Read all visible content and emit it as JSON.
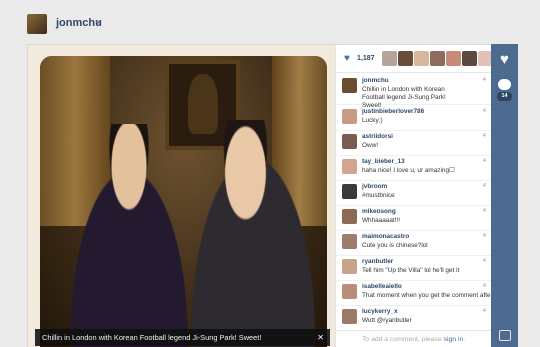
{
  "header": {
    "username": "jonmchu",
    "dropdown_icon": "chevron-down-icon"
  },
  "photo": {
    "caption": "Chillin in London with Korean Football legend Ji-Sung Park! Sweet!",
    "close_icon": "close-icon"
  },
  "likes": {
    "count": "1,187",
    "icon": "heart-icon",
    "liker_colors": [
      "#b5a49a",
      "#6a4c3a",
      "#d9b59b",
      "#8d6c5e",
      "#c98a7a",
      "#5b4a40",
      "#e2c2b6"
    ]
  },
  "comments": [
    {
      "user": "jonmchu",
      "text": "Chillin in London with Korean Football legend Ji-Sung Park! Sweet!",
      "time": "4",
      "avatar_color": "#6b4e2e"
    },
    {
      "user": "justinbieberlover786",
      "text": "Lucky;)",
      "time": "4",
      "avatar_color": "#c79a84"
    },
    {
      "user": "astriidorsi",
      "text": "Oww!",
      "time": "4",
      "avatar_color": "#7a5d52"
    },
    {
      "user": "tay_bieber_13",
      "text": "haha nice! I love u, ur amazing☐",
      "time": "4",
      "avatar_color": "#d1a58f"
    },
    {
      "user": "jvbroom",
      "text": "#mustbnice",
      "time": "4",
      "avatar_color": "#3a3a3a"
    },
    {
      "user": "mikeosong",
      "text": "Whhaaaaat!!!",
      "time": "4",
      "avatar_color": "#8c6a55"
    },
    {
      "user": "maimonacastro",
      "text": "Cute you is chinese?lol",
      "time": "4",
      "avatar_color": "#a07a6a"
    },
    {
      "user": "ryanbutler",
      "text": "Tell him \"Up the Villa\" lol he'll get it",
      "time": "4",
      "avatar_color": "#c9a28c"
    },
    {
      "user": "isabelleaiello",
      "text": "That moment when you get the comment after ryan ♥♥☐ @ryanbutler",
      "time": "4",
      "avatar_color": "#b88e7a"
    },
    {
      "user": "lucykerry_x",
      "text": "Wutt @ryanbutler",
      "time": "4",
      "avatar_color": "#9a7a66"
    }
  ],
  "add_comment": {
    "prefix": "To add a comment, please ",
    "link": "sign in",
    "suffix": "."
  },
  "actions": {
    "like_icon": "heart-icon",
    "comment_icon": "comment-bubble-icon",
    "comment_count": "14",
    "camera_icon": "camera-icon"
  }
}
